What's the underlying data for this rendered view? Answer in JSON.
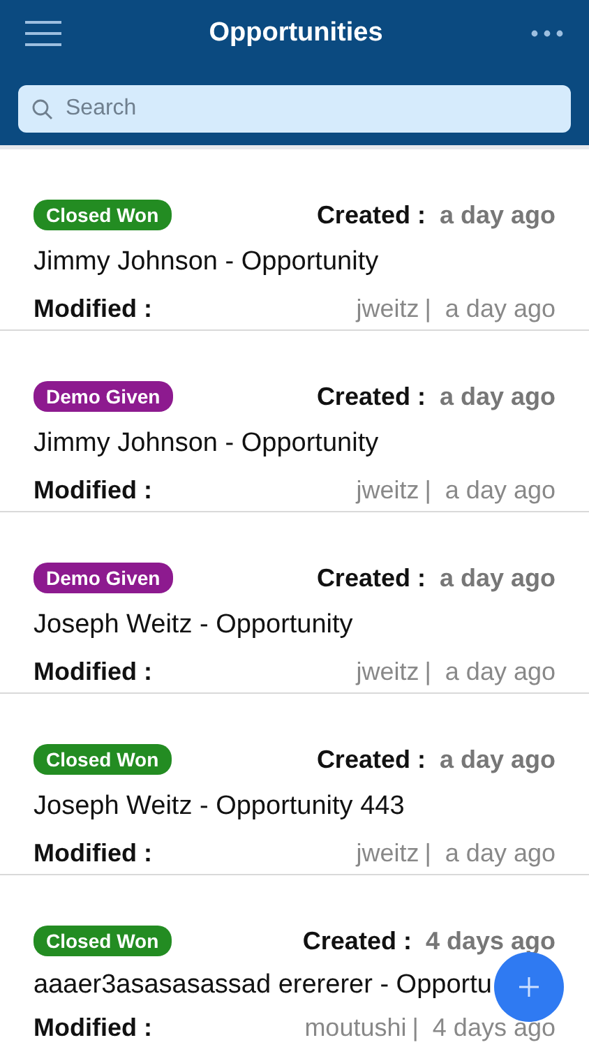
{
  "header": {
    "title": "Opportunities"
  },
  "search": {
    "placeholder": "Search"
  },
  "opportunities": [
    {
      "status": {
        "label": "Closed Won",
        "color": "#238c22"
      },
      "created_label": "Created :",
      "created": "a day ago",
      "name": "Jimmy Johnson - Opportunity",
      "modified_label": "Modified :",
      "modified_by": "jweitz",
      "separator": "|",
      "modified": "a day ago"
    },
    {
      "status": {
        "label": "Demo Given",
        "color": "#8d1a8f"
      },
      "created_label": "Created :",
      "created": "a day ago",
      "name": "Jimmy Johnson - Opportunity",
      "modified_label": "Modified :",
      "modified_by": "jweitz",
      "separator": "|",
      "modified": "a day ago"
    },
    {
      "status": {
        "label": "Demo Given",
        "color": "#8d1a8f"
      },
      "created_label": "Created :",
      "created": "a day ago",
      "name": "Joseph Weitz - Opportunity",
      "modified_label": "Modified :",
      "modified_by": "jweitz",
      "separator": "|",
      "modified": "a day ago"
    },
    {
      "status": {
        "label": "Closed Won",
        "color": "#238c22"
      },
      "created_label": "Created :",
      "created": "a day ago",
      "name": "Joseph Weitz - Opportunity 443",
      "modified_label": "Modified :",
      "modified_by": "jweitz",
      "separator": "|",
      "modified": "a day ago"
    },
    {
      "status": {
        "label": "Closed Won",
        "color": "#238c22"
      },
      "created_label": "Created :",
      "created": "4 days ago",
      "name": "aaaer3asasasassad erererer - Opportu",
      "modified_label": "Modified :",
      "modified_by": "moutushi",
      "separator": "|",
      "modified": "4 days ago"
    }
  ]
}
